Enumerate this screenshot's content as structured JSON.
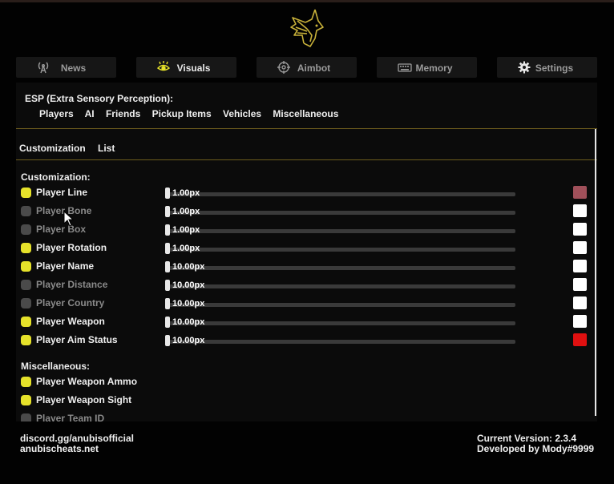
{
  "colors": {
    "accent_gold": "#c9b23a",
    "enabled_dot": "#e6e22a",
    "disabled_dot": "#4a4a4a",
    "enabled_text": "#f0f0f0",
    "disabled_text": "#8a8a8a"
  },
  "logo": {
    "icon": "anubis-logo-icon"
  },
  "tabs": [
    {
      "label": "News",
      "icon": "antenna-icon",
      "active": false
    },
    {
      "label": "Visuals",
      "icon": "eye-icon",
      "active": true
    },
    {
      "label": "Aimbot",
      "icon": "crosshair-icon",
      "active": false
    },
    {
      "label": "Memory",
      "icon": "keyboard-icon",
      "active": false
    },
    {
      "label": "Settings",
      "icon": "gear-icon",
      "active": false
    }
  ],
  "esp": {
    "title": "ESP (Extra Sensory Perception):",
    "subtabs": [
      "Players",
      "AI",
      "Friends",
      "Pickup Items",
      "Vehicles",
      "Miscellaneous"
    ]
  },
  "inner_tabs": [
    "Customization",
    "List"
  ],
  "customization": {
    "heading": "Customization:",
    "rows": [
      {
        "label": "Player Line",
        "enabled": true,
        "value": "1.00px",
        "level": 0,
        "color": "#a0505a"
      },
      {
        "label": "Player Bone",
        "enabled": false,
        "value": "1.00px",
        "level": 0,
        "color": "#ffffff"
      },
      {
        "label": "Player Box",
        "enabled": false,
        "value": "1.00px",
        "level": 0,
        "color": "#ffffff"
      },
      {
        "label": "Player Rotation",
        "enabled": true,
        "value": "1.00px",
        "level": 0,
        "color": "#ffffff"
      },
      {
        "label": "Player Name",
        "enabled": true,
        "value": "10.00px",
        "level": 0,
        "color": "#ffffff"
      },
      {
        "label": "Player Distance",
        "enabled": false,
        "value": "10.00px",
        "level": 0,
        "color": "#ffffff"
      },
      {
        "label": "Player Country",
        "enabled": false,
        "value": "10.00px",
        "level": 0,
        "color": "#ffffff"
      },
      {
        "label": "Player Weapon",
        "enabled": true,
        "value": "10.00px",
        "level": 0,
        "color": "#ffffff"
      },
      {
        "label": "Player Aim Status",
        "enabled": true,
        "value": "10.00px",
        "level": 0,
        "color": "#e01010"
      }
    ]
  },
  "miscellaneous": {
    "heading": "Miscellaneous:",
    "rows": [
      {
        "label": "Player Weapon Ammo",
        "enabled": true
      },
      {
        "label": "Player Weapon Sight",
        "enabled": true
      },
      {
        "label": "Player Team ID",
        "enabled": false
      }
    ]
  },
  "footer": {
    "discord": "discord.gg/anubisofficial",
    "website": "anubischeats.net",
    "version": "Current Version: 2.3.4",
    "developer": "Developed by Mody#9999"
  }
}
